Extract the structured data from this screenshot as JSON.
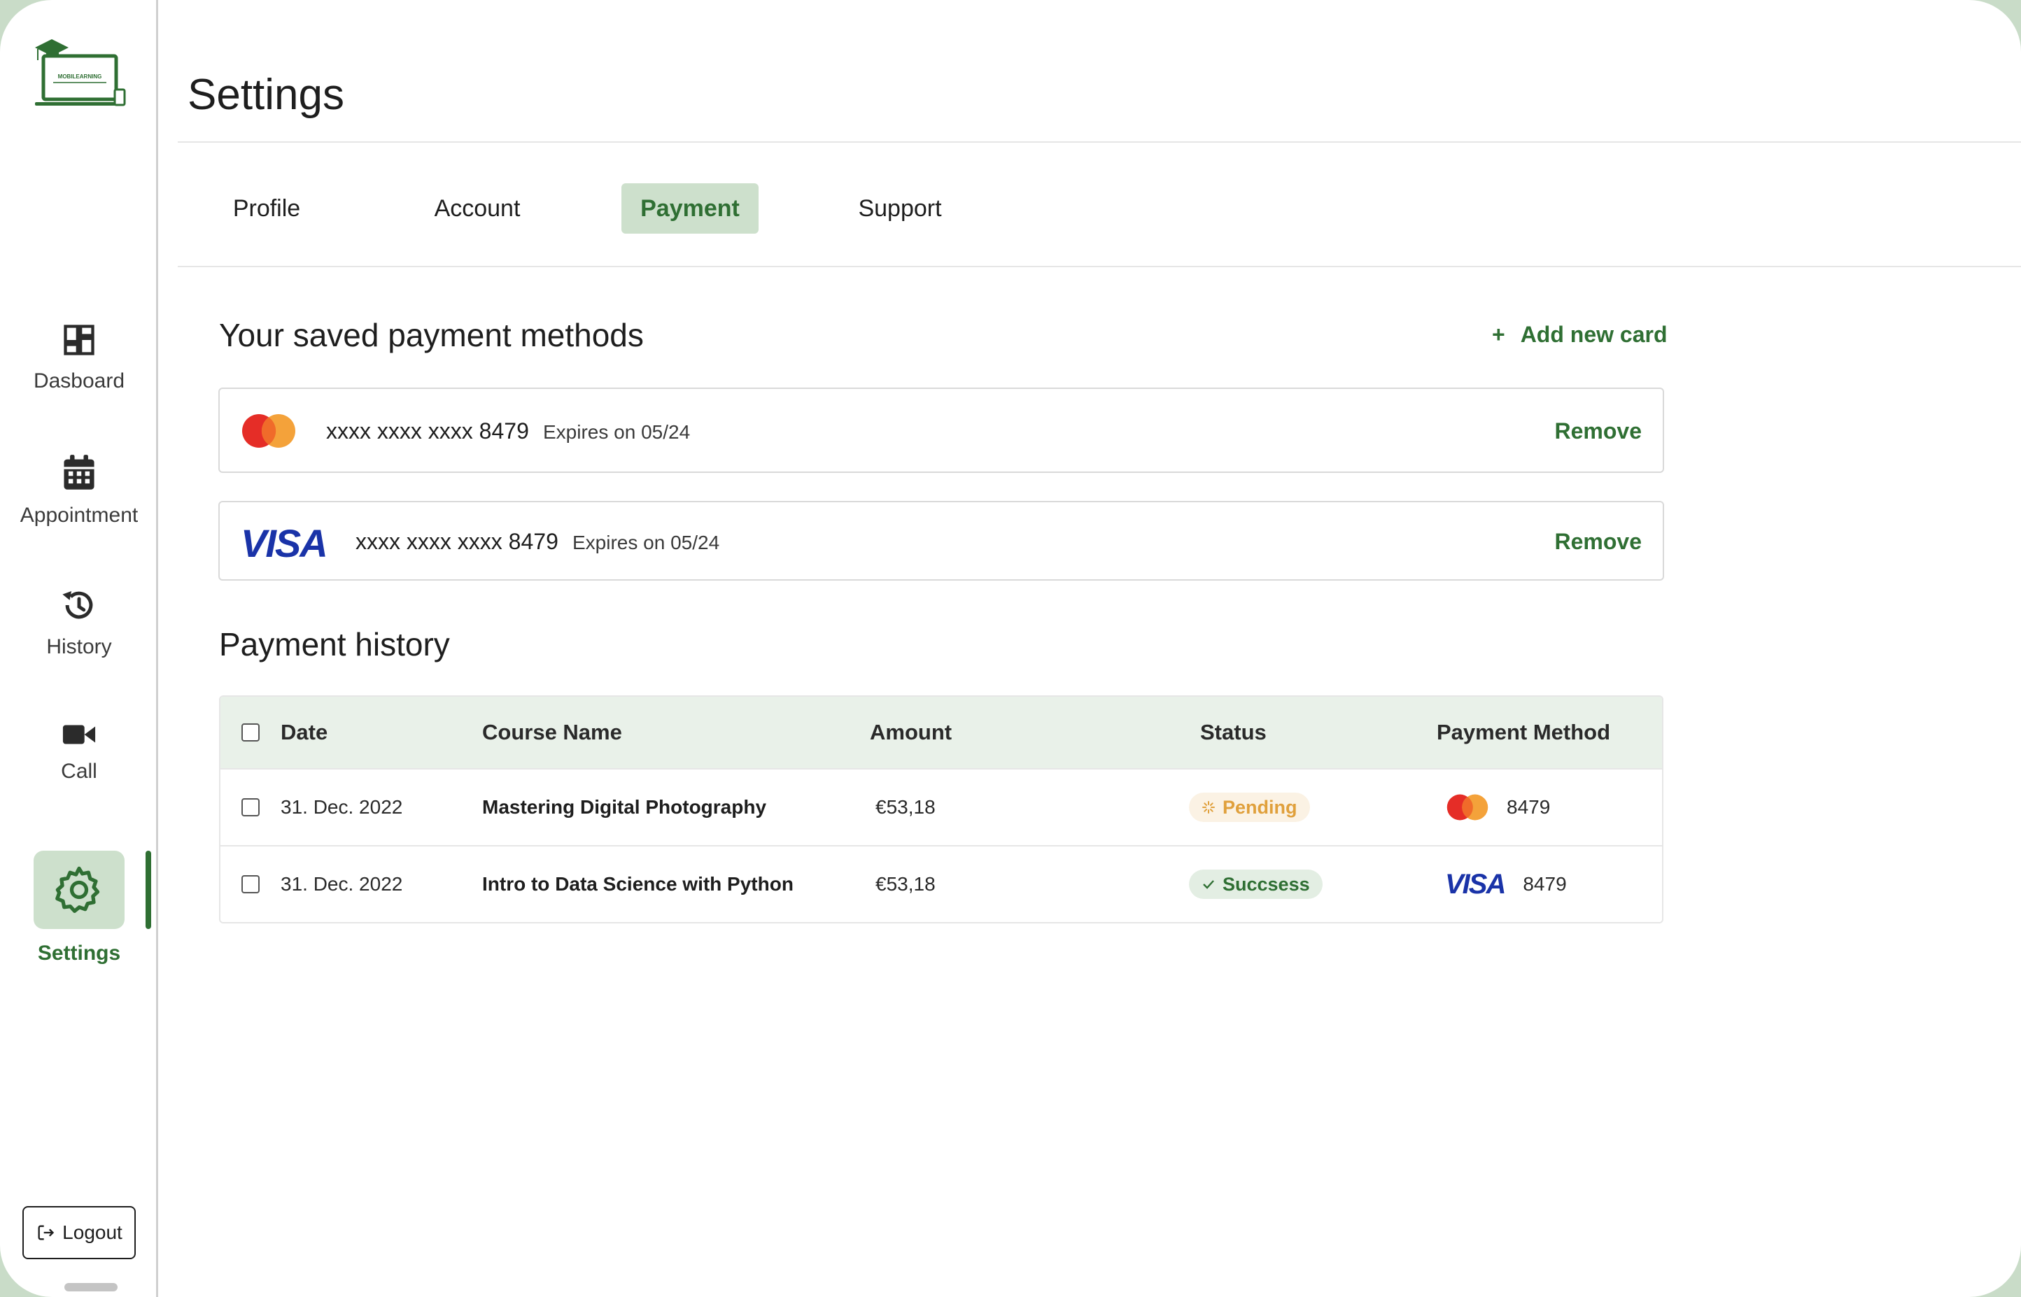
{
  "colors": {
    "accent": "#2f6f33",
    "accent_soft": "#cde0cc",
    "visa_blue": "#1a33a8",
    "mastercard_red": "#e52d27",
    "mastercard_orange": "#f4a23a",
    "pending": "#e0a03c"
  },
  "sidebar": {
    "logo_text": "MOBILEARNING",
    "items": [
      {
        "label": "Dasboard",
        "icon": "dashboard-icon"
      },
      {
        "label": "Appointment",
        "icon": "calendar-icon"
      },
      {
        "label": "History",
        "icon": "history-icon"
      },
      {
        "label": "Call",
        "icon": "video-camera-icon"
      },
      {
        "label": "Settings",
        "icon": "gear-icon",
        "active": true
      }
    ],
    "logout_label": "Logout"
  },
  "header": {
    "title": "Settings"
  },
  "tabs": [
    {
      "label": "Profile"
    },
    {
      "label": "Account"
    },
    {
      "label": "Payment",
      "active": true
    },
    {
      "label": "Support"
    }
  ],
  "saved_methods": {
    "title": "Your saved payment methods",
    "add_label": "Add new card",
    "cards": [
      {
        "brand": "mastercard",
        "number": "xxxx xxxx xxxx 8479",
        "expiry": "Expires on 05/24",
        "remove_label": "Remove"
      },
      {
        "brand": "visa",
        "brand_text": "VISA",
        "number": "xxxx xxxx xxxx 8479",
        "expiry": "Expires on 05/24",
        "remove_label": "Remove"
      }
    ]
  },
  "history": {
    "title": "Payment history",
    "columns": [
      "Date",
      "Course Name",
      "Amount",
      "Status",
      "Payment Method"
    ],
    "rows": [
      {
        "date": "31. Dec. 2022",
        "course": "Mastering Digital Photography",
        "amount": "€53,18",
        "status": "Pending",
        "method_brand": "mastercard",
        "method_last4": "8479"
      },
      {
        "date": "31. Dec. 2022",
        "course": "Intro to Data Science with Python",
        "amount": "€53,18",
        "status": "Succsess",
        "method_brand": "visa",
        "method_brand_text": "VISA",
        "method_last4": "8479"
      }
    ]
  }
}
